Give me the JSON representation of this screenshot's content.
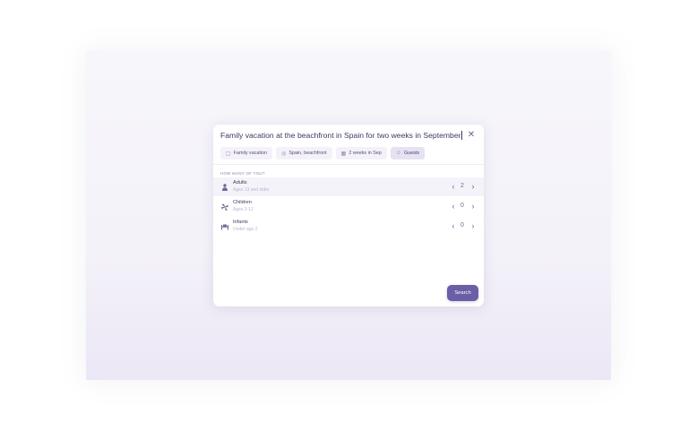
{
  "query": {
    "text": "Family vacation at the beachfront in Spain for two weeks in September"
  },
  "close_icon": "close-icon",
  "chips": [
    {
      "label": "Family vacation",
      "icon": "lock-icon",
      "glyph": "▢",
      "active": false
    },
    {
      "label": "Spain, beachfront",
      "icon": "map-pin-icon",
      "glyph": "◎",
      "active": false
    },
    {
      "label": "2 weeks in Sep",
      "icon": "calendar-icon",
      "glyph": "▦",
      "active": false
    },
    {
      "label": "Guests",
      "icon": "person-icon",
      "glyph": "☺",
      "active": true
    }
  ],
  "guests": {
    "section_label": "HOW MANY OF YOU?",
    "rows": [
      {
        "name": "Adults",
        "sub": "Ages 13 and older",
        "value": "2",
        "icon": "adult-icon"
      },
      {
        "name": "Children",
        "sub": "Ages 2-12",
        "value": "0",
        "icon": "child-icon"
      },
      {
        "name": "Infants",
        "sub": "Under age 2",
        "value": "0",
        "icon": "infant-icon"
      }
    ]
  },
  "search_button": {
    "label": "Search"
  },
  "colors": {
    "accent": "#6a5ea6",
    "text": "#3d3862",
    "muted": "#bab6cf"
  }
}
